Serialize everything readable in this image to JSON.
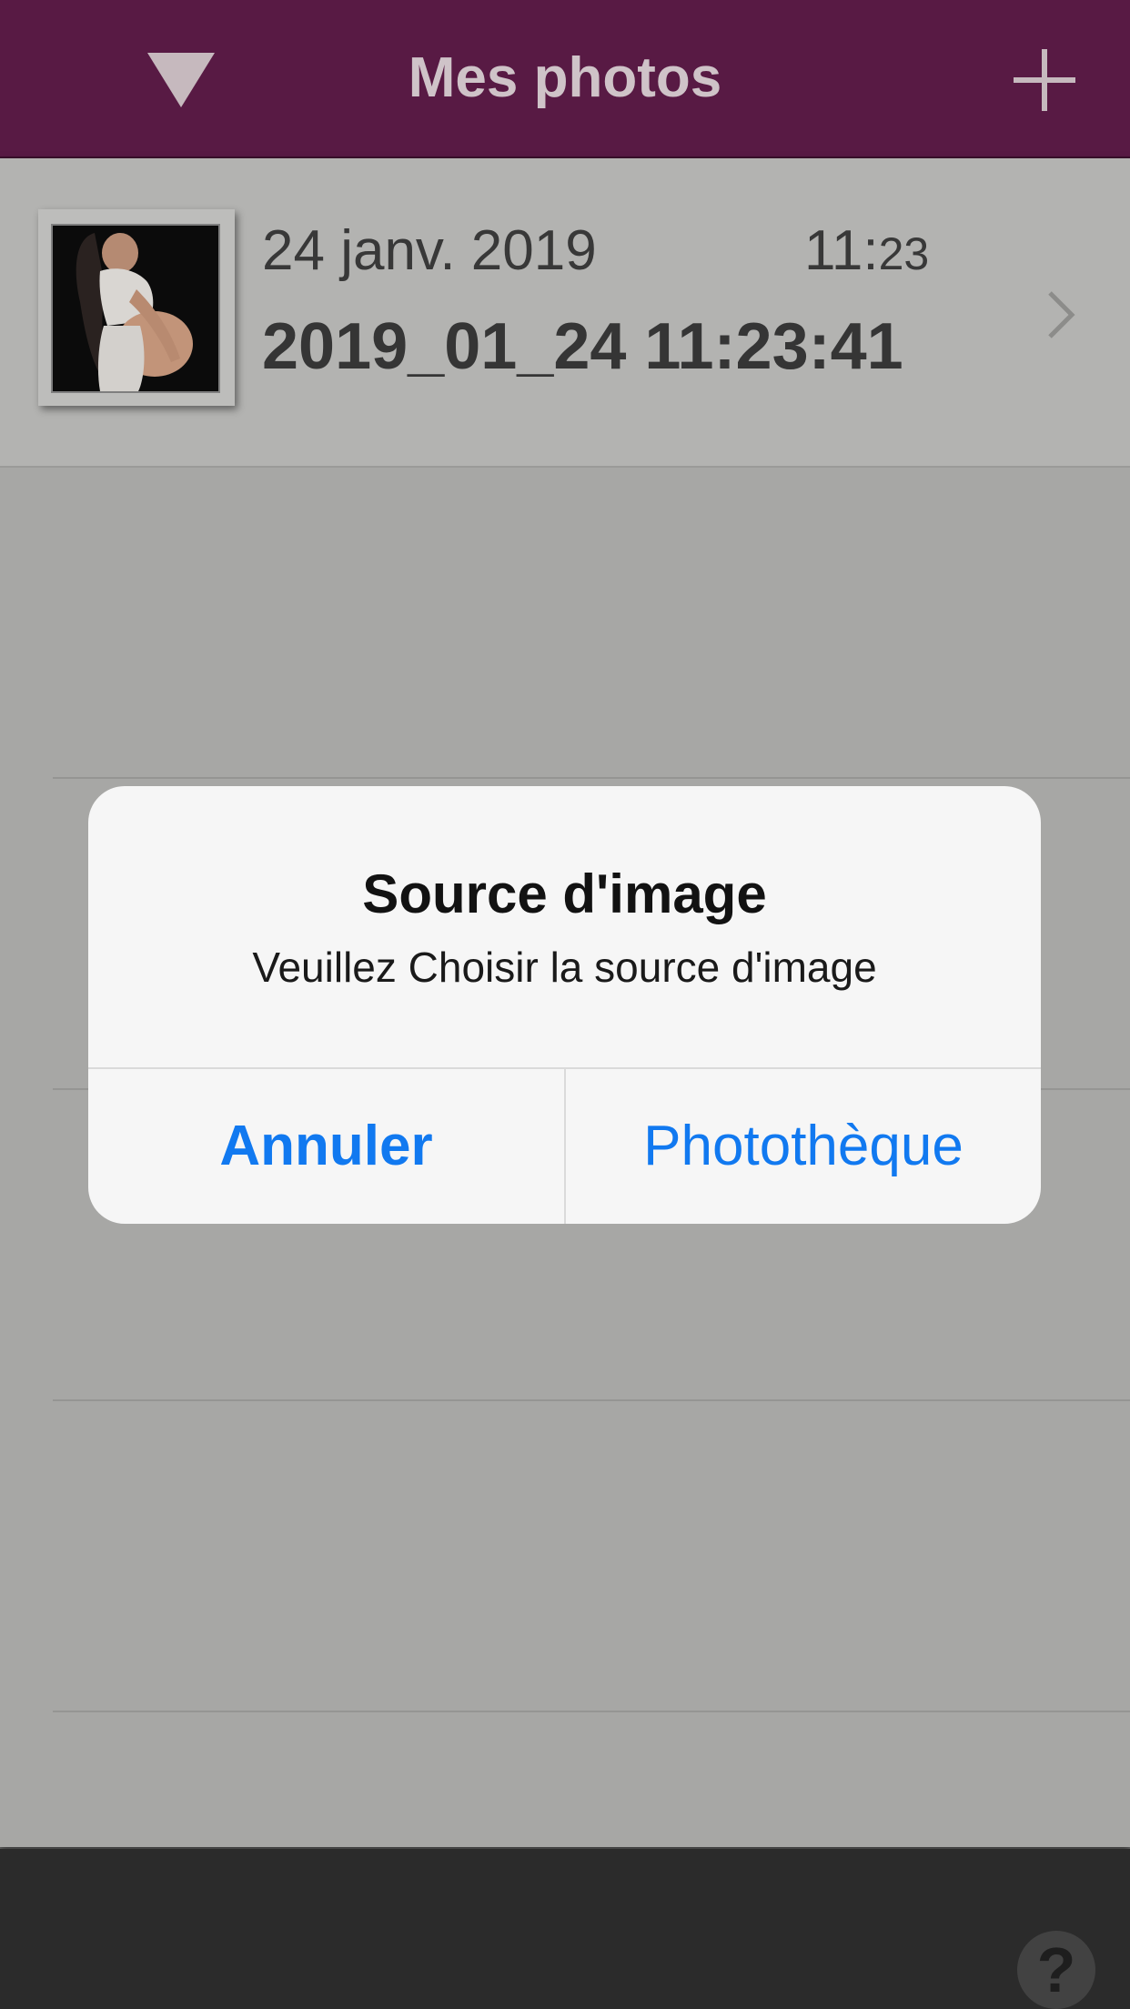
{
  "colors": {
    "navbar": "#581a44",
    "alert_button": "#1179f0"
  },
  "navbar": {
    "title": "Mes photos",
    "left_icon": "dropdown-triangle-icon",
    "right_icon": "plus-icon"
  },
  "list": {
    "items": [
      {
        "date": "24 janv. 2019",
        "time_hours": "11:",
        "time_minutes": "23",
        "name": "2019_01_24 11:23:41",
        "thumbnail": "pregnant-woman-photo",
        "accessory_icon": "chevron-right-icon"
      }
    ]
  },
  "toolbar": {
    "help_label": "?"
  },
  "alert": {
    "title": "Source d'image",
    "message": "Veuillez Choisir la source d'image",
    "cancel_label": "Annuler",
    "library_label": "Photothèque"
  }
}
